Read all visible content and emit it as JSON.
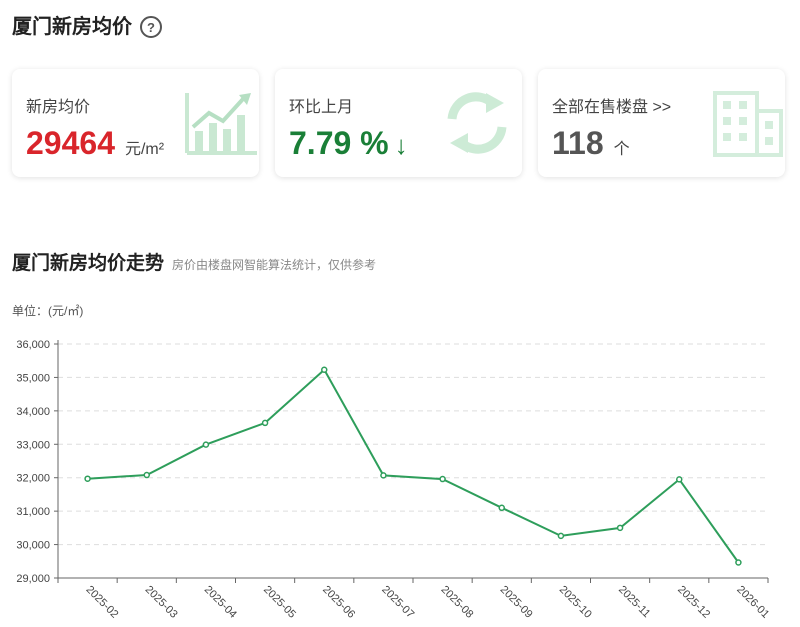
{
  "header": {
    "title": "厦门新房均价",
    "help_icon": "question-circle-icon"
  },
  "cards": [
    {
      "label": "新房均价",
      "value": "29464",
      "unit": "元/m²",
      "value_color": "#d9252b",
      "icon": "chart-growth-icon"
    },
    {
      "label": "环比上月",
      "value": "7.79 %",
      "arrow": "↓",
      "value_color": "#1a7f37",
      "icon": "refresh-icon"
    },
    {
      "label": "全部在售楼盘 >>",
      "value": "118",
      "unit": "个",
      "value_color": "#555555",
      "icon": "building-icon"
    }
  ],
  "trend": {
    "title": "厦门新房均价走势",
    "subtitle": "房价由楼盘网智能算法统计，仅供参考",
    "unit_label": "单位：(元/㎡)"
  },
  "colors": {
    "line": "#2e9e5b",
    "grid": "#dddddd",
    "axis_text": "#444444"
  },
  "chart_data": {
    "type": "line",
    "categories": [
      "2025-02",
      "2025-03",
      "2025-04",
      "2025-05",
      "2025-06",
      "2025-07",
      "2025-08",
      "2025-09",
      "2025-10",
      "2025-11",
      "2025-12",
      "2026-01"
    ],
    "series": [
      {
        "values": [
          31970,
          32080,
          32990,
          33640,
          35230,
          32070,
          31960,
          31100,
          30260,
          30500,
          31950,
          29464
        ]
      }
    ],
    "ylim": [
      29000,
      36000
    ],
    "yticks": [
      "29,000",
      "30,000",
      "31,000",
      "32,000",
      "33,000",
      "34,000",
      "35,000",
      "36,000"
    ],
    "grid": true,
    "legend": "none"
  }
}
